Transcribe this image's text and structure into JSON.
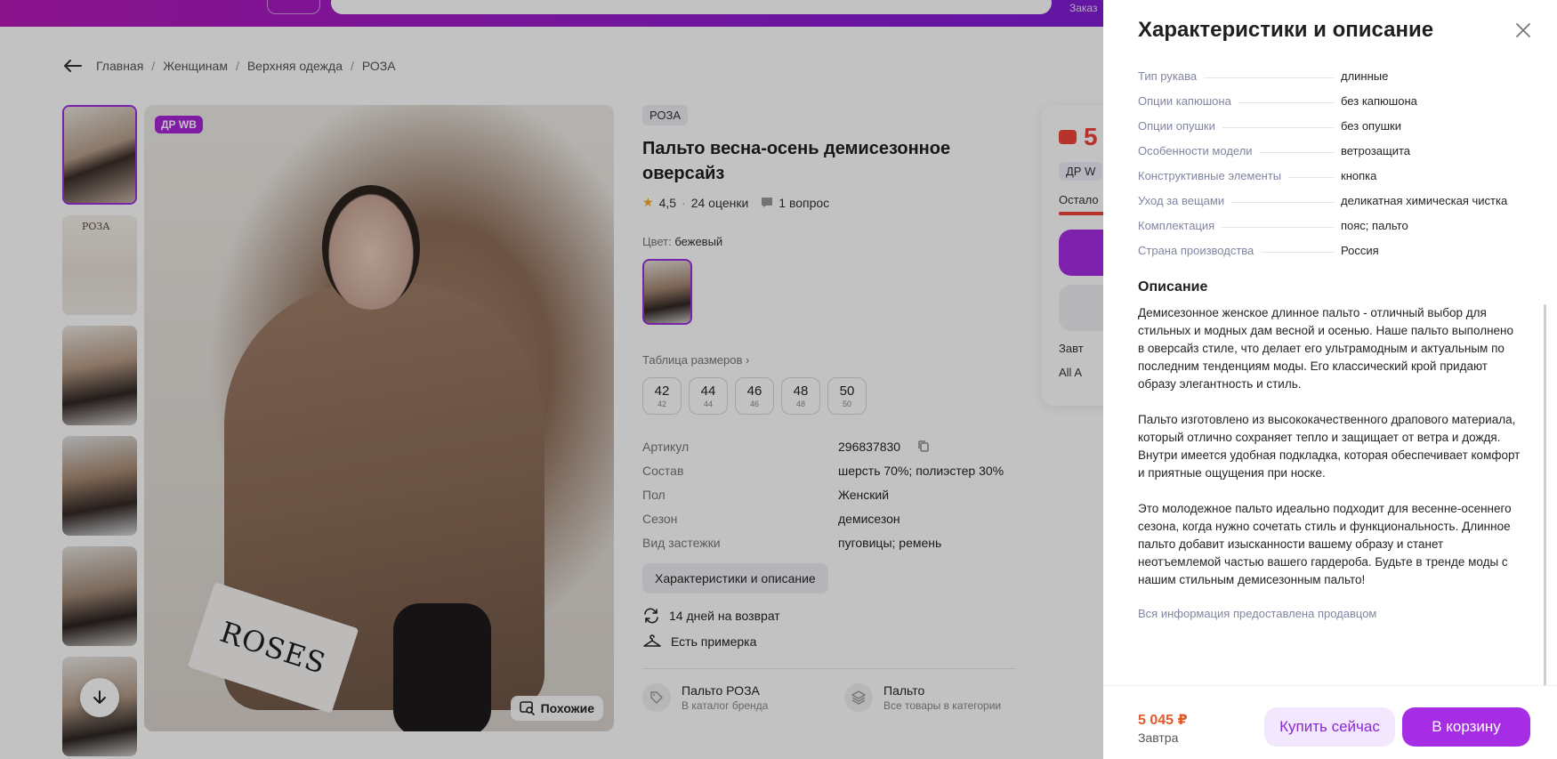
{
  "topbar": {
    "orders_label": "Заказ"
  },
  "breadcrumb": {
    "items": [
      "Главная",
      "Женщинам",
      "Верхняя одежда",
      "РОЗА"
    ],
    "separator": "/"
  },
  "gallery": {
    "badge": "ДР WB",
    "similar_label": "Похожие",
    "thumb2_brand": "РОЗА",
    "photo_text": "ROSES"
  },
  "product": {
    "brand": "РОЗА",
    "title": "Пальто весна-осень демисезонное оверсайз",
    "rating": "4,5",
    "reviews": "24 оценки",
    "questions": "1 вопрос",
    "color_label": "Цвет:",
    "color_value": "бежевый",
    "size_table_label": "Таблица размеров",
    "sizes": [
      {
        "size": "42",
        "ru": "42"
      },
      {
        "size": "44",
        "ru": "44"
      },
      {
        "size": "46",
        "ru": "46"
      },
      {
        "size": "48",
        "ru": "48"
      },
      {
        "size": "50",
        "ru": "50"
      }
    ],
    "specs": [
      {
        "k": "Артикул",
        "v": "296837830"
      },
      {
        "k": "Состав",
        "v": "шерсть 70%; полиэстер 30%"
      },
      {
        "k": "Пол",
        "v": "Женский"
      },
      {
        "k": "Сезон",
        "v": "демисезон"
      },
      {
        "k": "Вид застежки",
        "v": "пуговицы; ремень"
      }
    ],
    "char_button": "Характеристики и описание",
    "perks": [
      "14 дней на возврат",
      "Есть примерка"
    ],
    "brand_link": {
      "title": "Пальто РОЗА",
      "sub": "В каталог бренда"
    },
    "category_link": {
      "title": "Пальто",
      "sub": "Все товары в категории"
    }
  },
  "buybox": {
    "price_partial": "5",
    "dr_partial": "ДР W",
    "stock_partial": "Остало",
    "delivery_partial": "Завт",
    "all_partial": "All A"
  },
  "panel": {
    "title": "Характеристики и описание",
    "characteristics": [
      {
        "k": "Тип рукава",
        "v": "длинные"
      },
      {
        "k": "Опции капюшона",
        "v": "без капюшона"
      },
      {
        "k": "Опции опушки",
        "v": "без опушки"
      },
      {
        "k": "Особенности модели",
        "v": "ветрозащита"
      },
      {
        "k": "Конструктивные элементы",
        "v": "кнопка"
      },
      {
        "k": "Уход за вещами",
        "v": "деликатная химическая чистка"
      },
      {
        "k": "Комплектация",
        "v": "пояс; пальто"
      },
      {
        "k": "Страна производства",
        "v": "Россия"
      }
    ],
    "description_title": "Описание",
    "description": [
      "Демисезонное женское длинное пальто - отличный выбор для стильных и модных дам весной и осенью. Наше пальто выполнено в оверсайз стиле, что делает его ультрамодным и актуальным по последним тенденциям моды. Его классический крой придают образу элегантность и стиль.",
      "Пальто изготовлено из высококачественного драпового материала, который отлично сохраняет тепло и защищает от ветра и дождя. Внутри имеется удобная подкладка, которая обеспечивает комфорт и приятные ощущения при носке.",
      "Это молодежное пальто идеально подходит для весенне-осеннего сезона, когда нужно сочетать стиль и функциональность. Длинное пальто добавит изысканности вашему образу и станет неотъемлемой частью вашего гардероба. Будьте в тренде моды с нашим стильным демисезонным пальто!"
    ],
    "seller_note": "Вся информация предоставлена продавцом",
    "footer": {
      "price": "5 045 ₽",
      "delivery": "Завтра",
      "buy_now": "Купить сейчас",
      "add_to_cart": "В корзину"
    }
  },
  "colors": {
    "accent": "#a62de4",
    "price": "#e4592c",
    "muted_label": "#8086a0"
  }
}
